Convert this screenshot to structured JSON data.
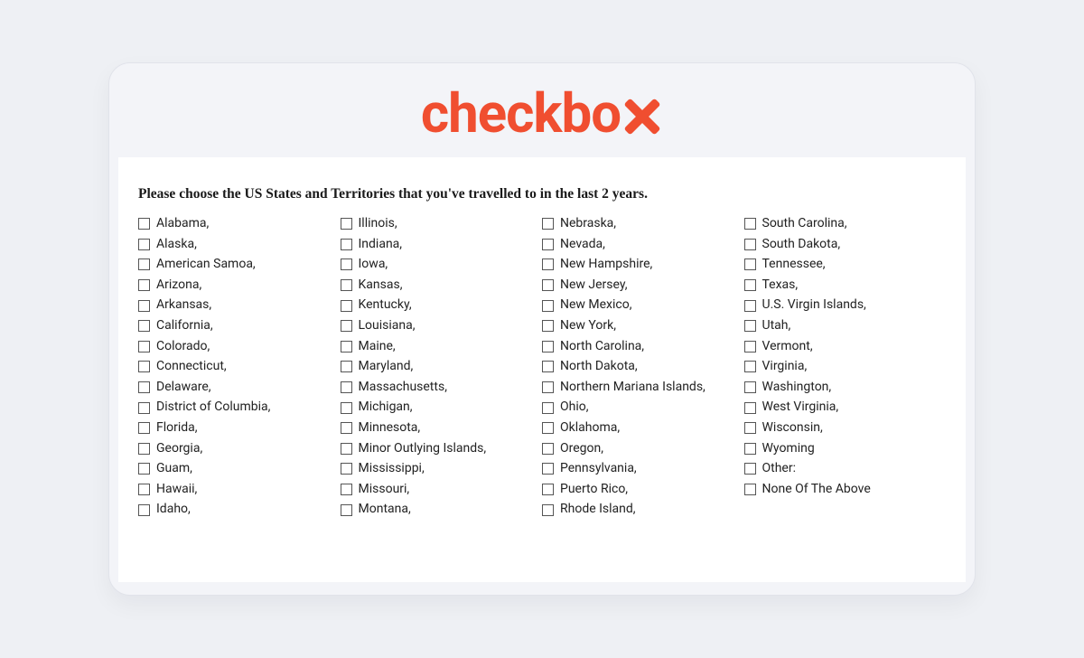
{
  "logo": {
    "text": "checkbo"
  },
  "question": "Please choose the US States and Territories that you've travelled to in the last 2 years.",
  "options": [
    "Alabama,",
    "Alaska,",
    "American Samoa,",
    "Arizona,",
    "Arkansas,",
    "California,",
    "Colorado,",
    "Connecticut,",
    "Delaware,",
    "District of Columbia,",
    "Florida,",
    "Georgia,",
    "Guam,",
    "Hawaii,",
    "Idaho,",
    "Illinois,",
    "Indiana,",
    "Iowa,",
    "Kansas,",
    "Kentucky,",
    "Louisiana,",
    "Maine,",
    "Maryland,",
    "Massachusetts,",
    "Michigan,",
    "Minnesota,",
    "Minor Outlying Islands,",
    "Mississippi,",
    "Missouri,",
    "Montana,",
    "Nebraska,",
    "Nevada,",
    "New Hampshire,",
    "New Jersey,",
    "New Mexico,",
    "New York,",
    "North Carolina,",
    "North Dakota,",
    "Northern Mariana Islands,",
    "Ohio,",
    "Oklahoma,",
    "Oregon,",
    "Pennsylvania,",
    "Puerto Rico,",
    "Rhode Island,",
    "South Carolina,",
    "South Dakota,",
    "Tennessee,",
    "Texas,",
    "U.S. Virgin Islands,",
    "Utah,",
    "Vermont,",
    "Virginia,",
    "Washington,",
    "West Virginia,",
    "Wisconsin,",
    "Wyoming",
    "Other:",
    "None Of The Above"
  ]
}
